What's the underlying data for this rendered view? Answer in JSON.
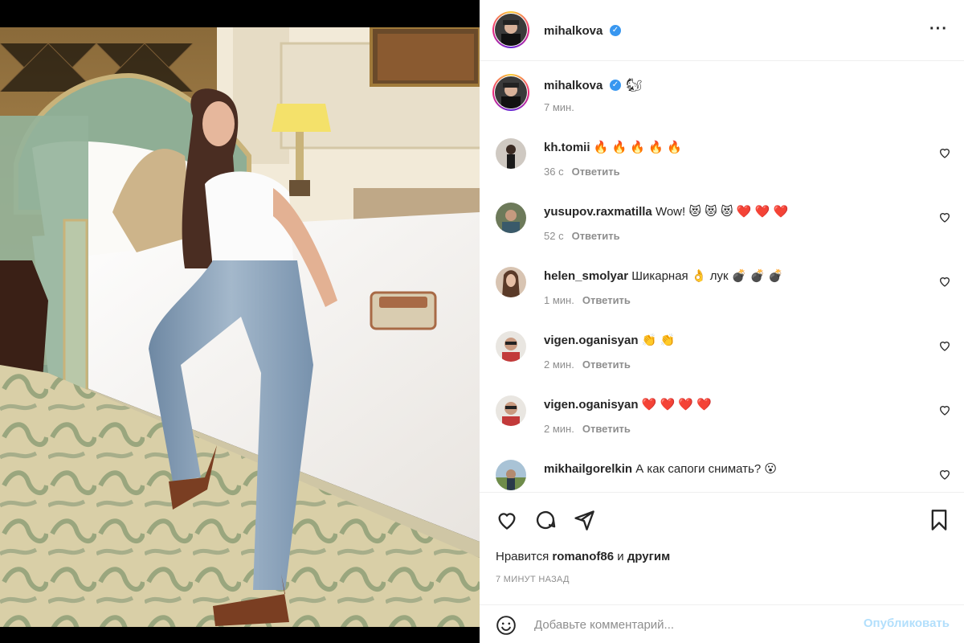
{
  "post": {
    "author": "mihalkova",
    "author_avatar": "avatar-photo"
  },
  "caption": {
    "username": "mihalkova",
    "emoji": "🐿",
    "time": "7 мин."
  },
  "comments": [
    {
      "username": "kh.tomii",
      "text": " 🔥 🔥 🔥 🔥 🔥",
      "time": "36 с",
      "reply": "Ответить"
    },
    {
      "username": "yusupov.raxmatilla",
      "text": " Wow! 😻 😻 😻 ❤️ ❤️ ❤️",
      "time": "52 с",
      "reply": "Ответить"
    },
    {
      "username": "helen_smolyar",
      "text": " Шикарная 👌 лук 💣 💣 💣",
      "time": "1 мин.",
      "reply": "Ответить"
    },
    {
      "username": "vigen.oganisyan",
      "text": " 👏 👏",
      "time": "2 мин.",
      "reply": "Ответить"
    },
    {
      "username": "vigen.oganisyan",
      "text": " ❤️ ❤️ ❤️ ❤️",
      "time": "2 мин.",
      "reply": "Ответить"
    },
    {
      "username": "mikhailgorelkin",
      "text": " А как сапоги снимать? 😮",
      "time": "",
      "reply": ""
    }
  ],
  "likes": {
    "prefix": "Нравится ",
    "user": "romanof86",
    "middle": " и ",
    "others": "другим"
  },
  "time_ago": "7 МИНУТ НАЗАД",
  "composer": {
    "placeholder": "Добавьте комментарий...",
    "publish_label": "Опубликовать"
  },
  "icons": {
    "more": "more-icon",
    "like": "heart-icon",
    "comment": "comment-icon",
    "share": "share-icon",
    "save": "bookmark-icon",
    "emoji": "smile-icon"
  },
  "colors": {
    "verified": "#3897f0",
    "publish_disabled": "#b2dffc",
    "muted": "#8e8e8e"
  }
}
